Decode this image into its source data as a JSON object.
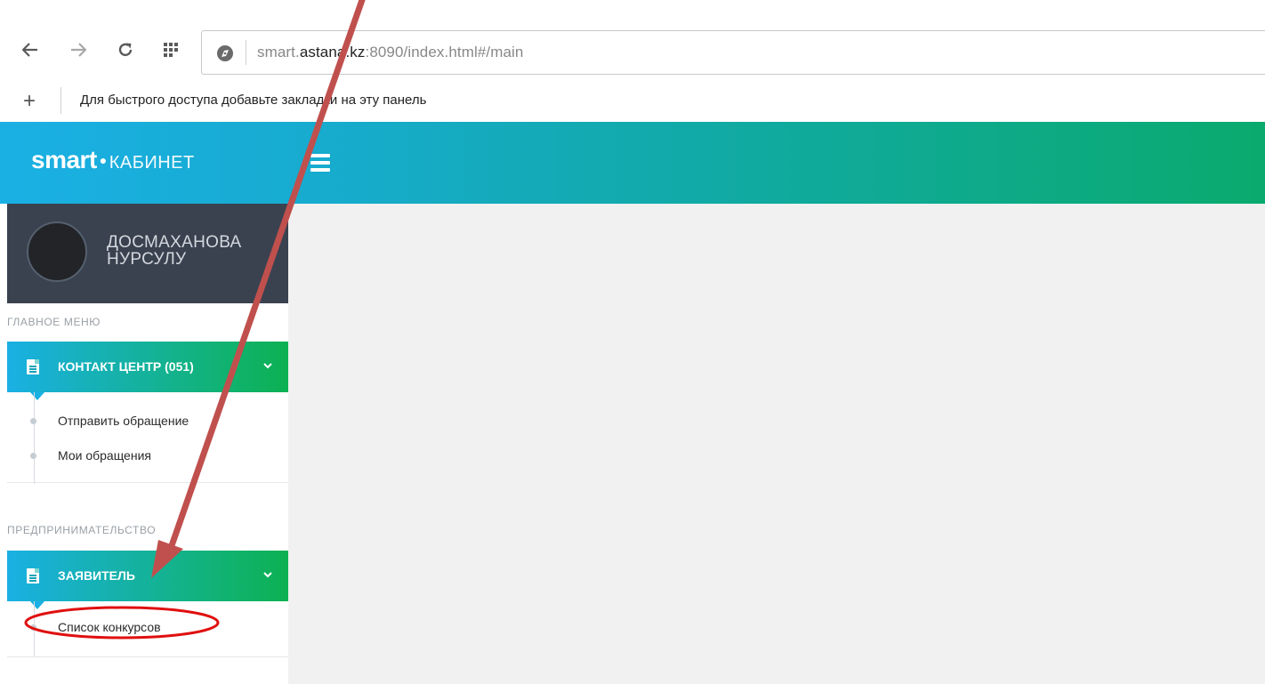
{
  "browser": {
    "url_prefix": "smart.",
    "url_host": "astana.kz",
    "url_rest": ":8090/index.html#/main",
    "bookmarks_hint": "Для быстрого доступа добавьте закладки на эту панель",
    "add_bookmark": "+"
  },
  "header": {
    "logo_main": "smart",
    "logo_dot": "●",
    "logo_sub": "КАБИНЕТ"
  },
  "user": {
    "name_line1": "ДОСМАХАНОВА",
    "name_line2": "НУРСУЛУ"
  },
  "sidebar": {
    "section1": {
      "label": "ГЛАВНОЕ МЕНЮ",
      "menu_title": "КОНТАКТ ЦЕНТР (051)",
      "items": [
        {
          "label": "Отправить обращение"
        },
        {
          "label": "Мои обращения"
        }
      ]
    },
    "section2": {
      "label": "ПРЕДПРИНИМАТЕЛЬСТВО",
      "menu_title": "ЗАЯВИТЕЛЬ",
      "items": [
        {
          "label": "Список конкурсов"
        }
      ]
    }
  },
  "colors": {
    "header_gradient_start": "#1ab0e4",
    "header_gradient_end": "#0aaa6e",
    "user_panel": "#3a4250",
    "content_bg": "#f1f1f1",
    "annotation_arrow": "#c0504d",
    "annotation_circle": "#e01010"
  },
  "icons": {
    "back": "arrow-left-icon",
    "forward": "arrow-right-icon",
    "reload": "reload-icon",
    "apps": "apps-grid-icon",
    "site_info": "site-info-icon",
    "menu": "hamburger-icon",
    "document": "document-icon",
    "chevron": "chevron-down-icon"
  }
}
